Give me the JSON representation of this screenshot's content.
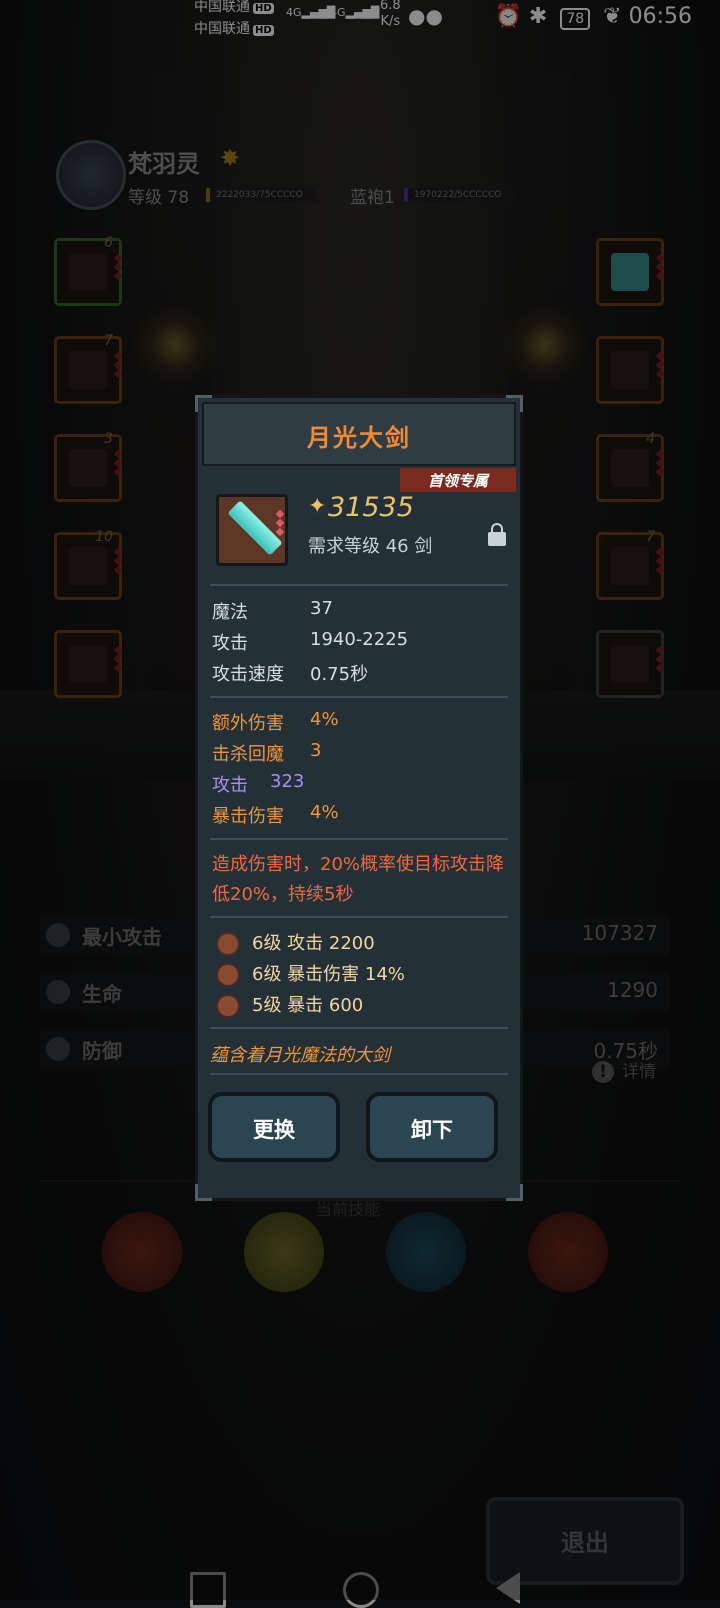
{
  "status_bar": {
    "carrier1": "中国联通",
    "carrier2": "中国联通",
    "hd": "HD",
    "net1": "4G",
    "net2": "4G",
    "speed_value": "6.8",
    "speed_unit": "K/s",
    "battery": "78",
    "time": "06:56"
  },
  "player": {
    "name": "梵羽灵",
    "level": "等级 78",
    "xp_text": "2222033/75CCCCO",
    "robe": "蓝袍1",
    "robe_xp_text": "1970222/5CCCCCO"
  },
  "left_slots": [
    {
      "num": "6"
    },
    {
      "num": "7"
    },
    {
      "num": "3"
    },
    {
      "num": "10"
    },
    {
      "num": ""
    }
  ],
  "right_slots": [
    {
      "num": ""
    },
    {
      "num": ""
    },
    {
      "num": "4"
    },
    {
      "num": "7"
    },
    {
      "num": ""
    }
  ],
  "stats": [
    {
      "label": "最小攻击",
      "value": "107327"
    },
    {
      "label": "生命",
      "value": "1290"
    },
    {
      "label": "防御",
      "value": "0.75秒"
    }
  ],
  "detail_label": "详情",
  "skills_title": "当前技能",
  "exit_label": "退出",
  "item": {
    "title": "月光大剑",
    "badge": "首领专属",
    "power": "31535",
    "requirement": "需求等级 46   剑",
    "base_stats": [
      {
        "key": "魔法",
        "value": "37"
      },
      {
        "key": "攻击",
        "value": "1940-2225"
      },
      {
        "key": "攻击速度",
        "value": "0.75秒"
      }
    ],
    "bonus_stats": [
      {
        "key": "额外伤害",
        "value": "4%",
        "color": "orange"
      },
      {
        "key": "击杀回魔",
        "value": "3",
        "color": "orange"
      },
      {
        "key": "攻击",
        "value": "323",
        "color": "purple"
      },
      {
        "key": "暴击伤害",
        "value": "4%",
        "color": "orange"
      }
    ],
    "effect": "造成伤害时，20%概率使目标攻击降低20%，持续5秒",
    "gems": [
      {
        "text": "6级   攻击 2200"
      },
      {
        "text": "6级   暴击伤害 14%"
      },
      {
        "text": "5级   暴击 600"
      }
    ],
    "flavor": "蕴含着月光魔法的大剑",
    "btn_replace": "更换",
    "btn_remove": "卸下"
  },
  "colors": {
    "title_orange": "#f08a37",
    "bonus_orange": "#f0953a",
    "bonus_purple": "#a98ff4",
    "effect_red": "#f26a3a",
    "power_gold": "#e8c36a"
  }
}
